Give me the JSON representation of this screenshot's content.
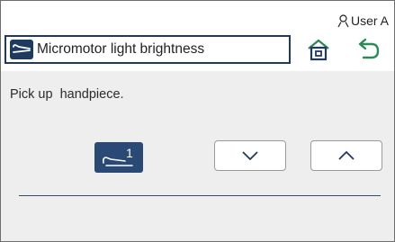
{
  "header": {
    "user_label": "User A",
    "title": "Micromotor light brightness",
    "title_icon": "micromotor-icon",
    "home_icon": "home-icon",
    "back_icon": "back-arrow-icon"
  },
  "main": {
    "instruction": "Pick up  handpiece.",
    "handpiece_number": "1",
    "handpiece_icon": "handpiece-icon",
    "down_icon": "chevron-down-icon",
    "up_icon": "chevron-up-icon"
  },
  "colors": {
    "navy": "#1f3a5f",
    "accent_green": "#2e8b57",
    "panel_bg": "#eeeeee"
  }
}
